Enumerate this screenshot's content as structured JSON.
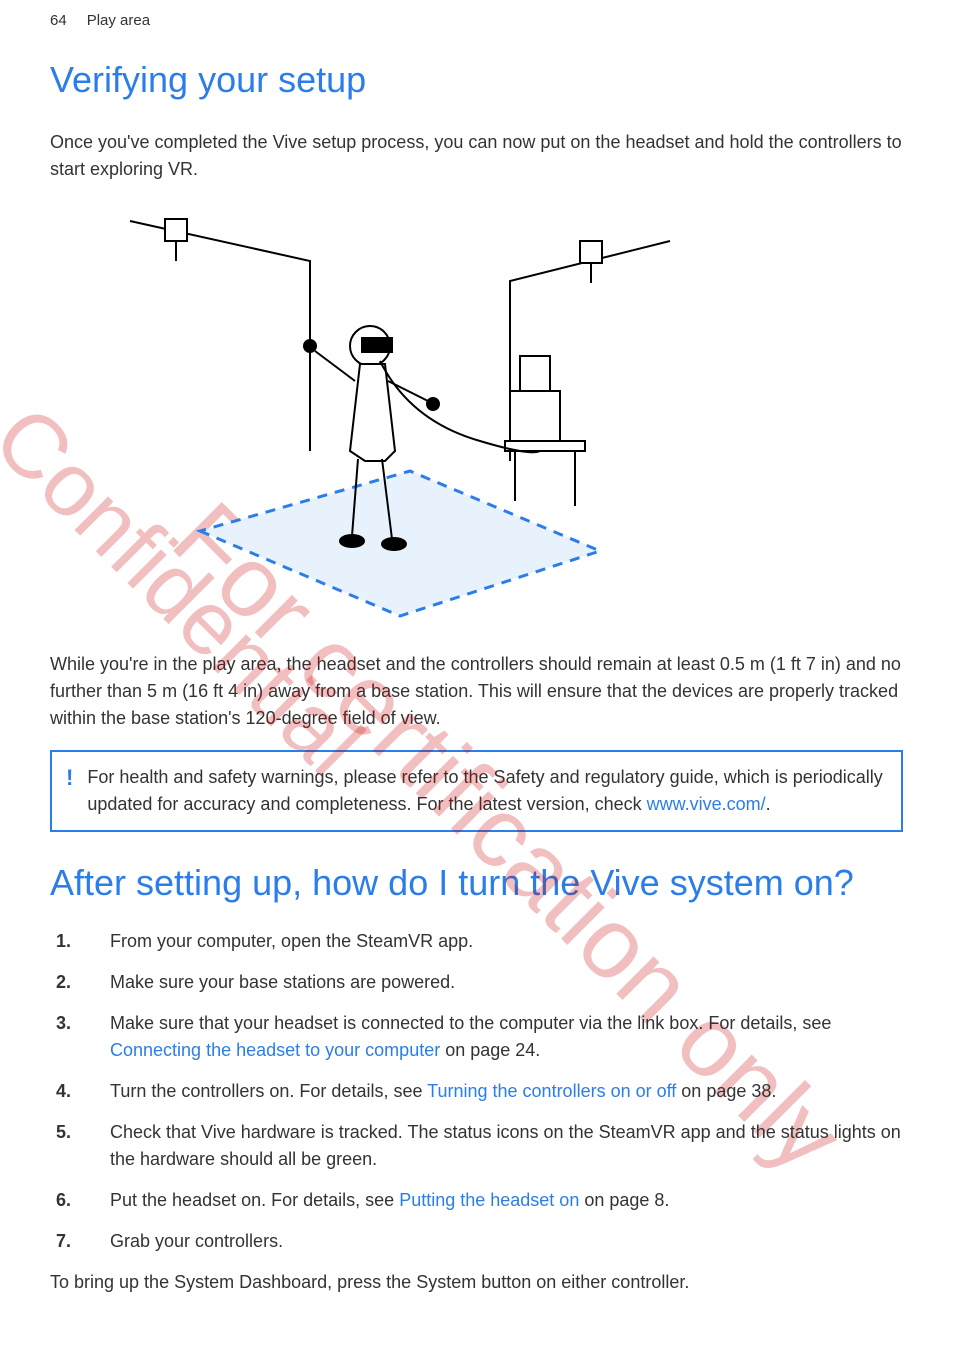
{
  "header": {
    "page_number": "64",
    "section": "Play area"
  },
  "title1": "Verifying your setup",
  "intro": "Once you've completed the Vive setup process, you can now put on the headset and hold the controllers to start exploring VR.",
  "play_area_text": "While you're in the play area, the headset and the controllers should remain at least 0.5 m (1 ft 7 in) and no further than 5 m (16 ft 4 in) away from a base station. This will ensure that the devices are properly tracked within the base station's 120-degree field of view.",
  "note": {
    "icon": "!",
    "text_before_link": "For health and safety warnings, please refer to the Safety and regulatory guide, which is periodically updated for accuracy and completeness. For the latest version, check ",
    "link_text": "www.vive.com/",
    "text_after_link": "."
  },
  "title2": "After setting up, how do I turn the Vive system on?",
  "steps": [
    {
      "text": "From your computer, open the SteamVR app."
    },
    {
      "text": "Make sure your base stations are powered."
    },
    {
      "before": "Make sure that your headset is connected to the computer via the link box. For details, see ",
      "link": "Connecting the headset to your computer",
      "after": " on page 24."
    },
    {
      "before": "Turn the controllers on. For details, see ",
      "link": "Turning the controllers on or off",
      "after": " on page 38."
    },
    {
      "text": "Check that Vive hardware is tracked. The status icons on the SteamVR app and the status lights on the hardware should all be green."
    },
    {
      "before": "Put the headset on. For details, see ",
      "link": "Putting the headset on",
      "after": " on page 8."
    },
    {
      "text": "Grab your controllers."
    }
  ],
  "closing": "To bring up the System Dashboard, press the System button on either controller.",
  "watermarks": {
    "wm1": "Confidential",
    "wm2": "For certification only"
  }
}
